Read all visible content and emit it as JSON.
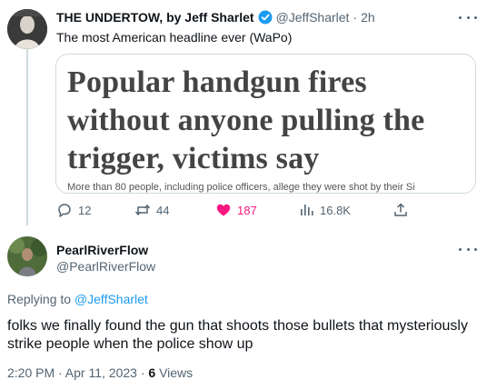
{
  "tweet": {
    "author_name": "THE UNDERTOW, by Jeff Sharlet",
    "handle": "@JeffSharlet",
    "separator": "·",
    "time": "2h",
    "text": "The most American headline ever (WaPo)",
    "card": {
      "headline": "Popular handgun fires without anyone pulling the trigger, victims say",
      "dek": "More than 80 people, including police officers, allege they were shot by their Si"
    },
    "actions": {
      "replies": "12",
      "retweets": "44",
      "likes": "187",
      "views": "16.8K"
    },
    "colors": {
      "like_active": "#f91880",
      "verified": "#1d9bf0"
    }
  },
  "reply": {
    "author_name": "PearlRiverFlow",
    "handle": "@PearlRiverFlow",
    "replying_to_prefix": "Replying to",
    "replying_to_handle": "@JeffSharlet",
    "text": "folks we finally found the gun that shoots those bullets that mysteriously strike people when the police show up",
    "timestamp": "2:20 PM · Apr 11, 2023 ·",
    "views_count": "6",
    "views_label": "Views"
  }
}
